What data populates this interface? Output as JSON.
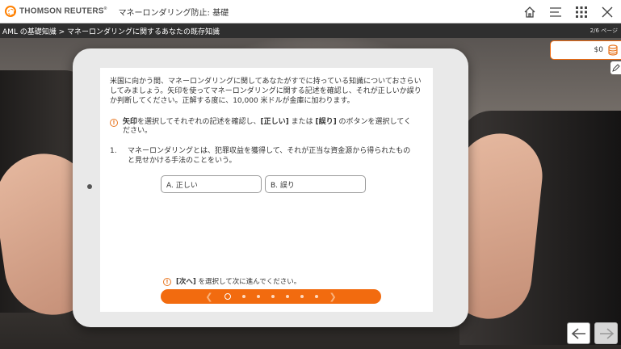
{
  "header": {
    "brand": "THOMSON REUTERS",
    "brand_mark": "®",
    "course_title": "マネーロンダリング防止: 基礎",
    "icons": [
      "home-icon",
      "menu-icon",
      "grid-icon",
      "close-icon"
    ]
  },
  "breadcrumb": {
    "text": "AML の基礎知識 > マネーロンダリングに関するあなたの既存知識",
    "page_indicator": "2/6 ページ"
  },
  "score": {
    "value": "$0",
    "icon": "coins-icon"
  },
  "screen": {
    "intro": "米国に向かう間、マネーロンダリングに関してあなたがすでに持っている知識についておさらいしてみましょう。矢印を使ってマネーロンダリングに関する記述を確認し、それが正しいか誤りか判断してください。正解する度に、10,000 米ドルが金庫に加わります。",
    "hint": {
      "t1": "矢印",
      "t2": "を選択してそれぞれの記述を確認し、",
      "t3": "[正しい]",
      "t4": " または ",
      "t5": "[誤り]",
      "t6": " のボタンを選択してください。"
    },
    "question": {
      "number": "1.",
      "text": "マネーロンダリングとは、犯罪収益を獲得して、それが正当な資金源から得られたものと見せかける手法のことをいう。"
    },
    "choices": [
      {
        "label": "A.  正しい"
      },
      {
        "label": "B.  誤り"
      }
    ],
    "next_hint": {
      "bold": "[次へ]",
      "rest": " を選択して次に進んでください。"
    },
    "progress": {
      "total": 7,
      "current": 1
    }
  },
  "colors": {
    "accent": "#f26b0f",
    "dark_bar": "#2f2f2f"
  }
}
